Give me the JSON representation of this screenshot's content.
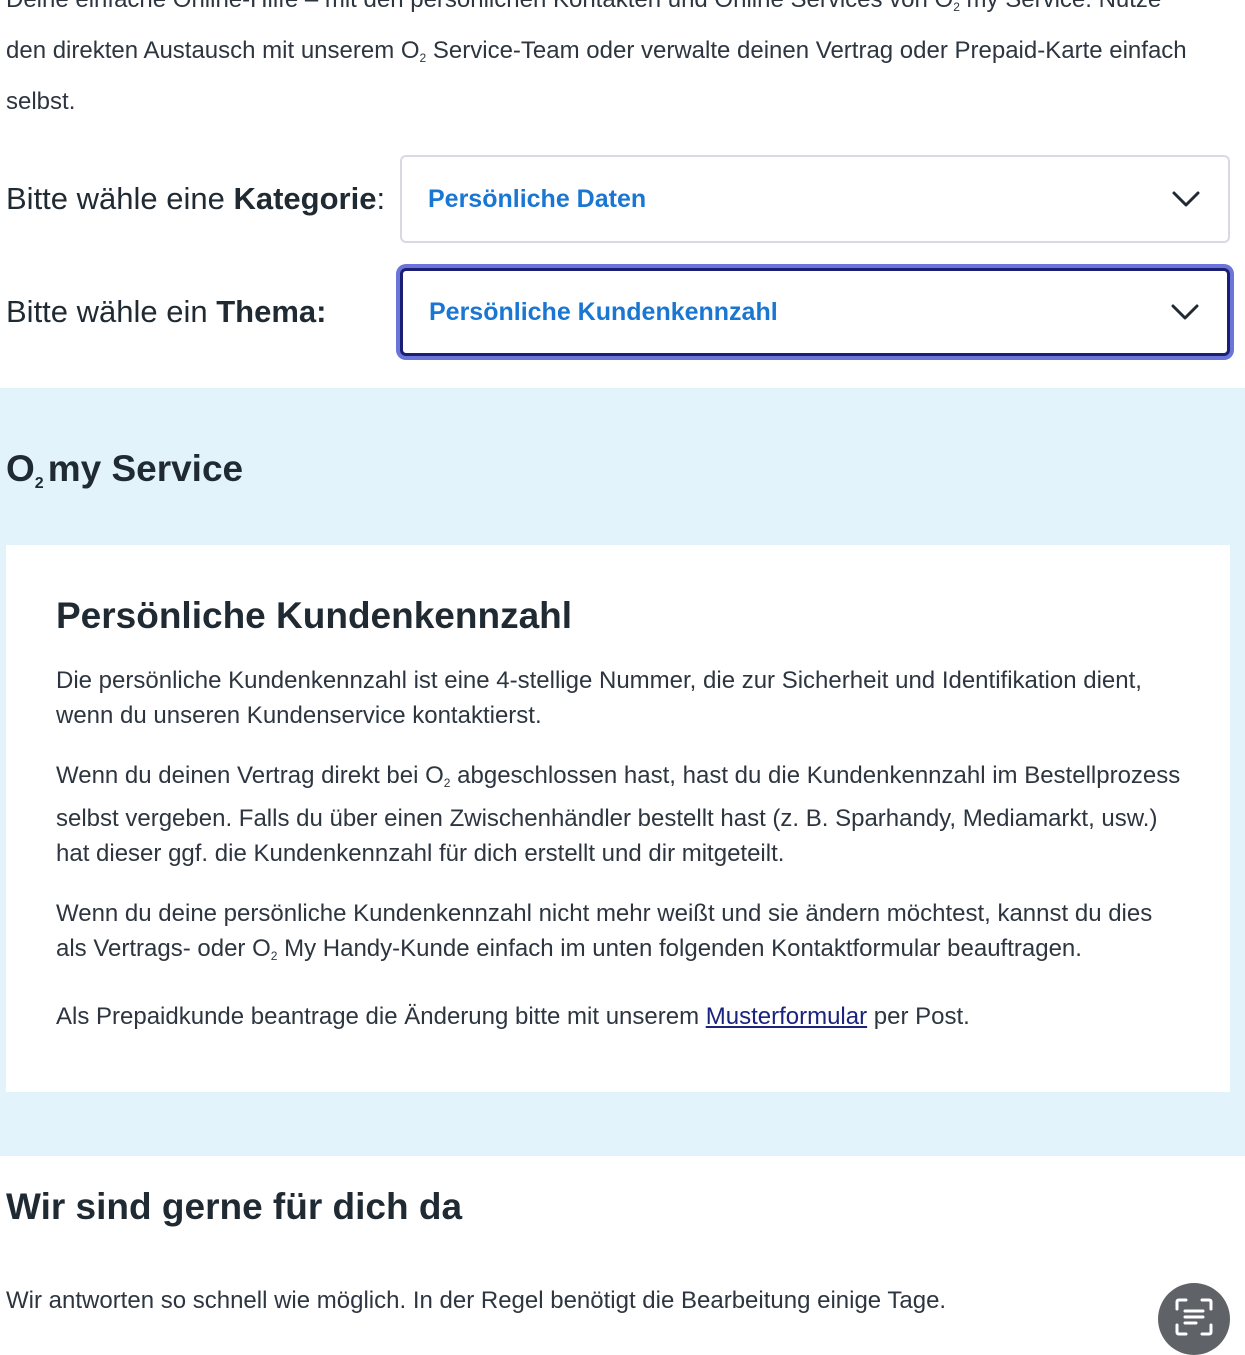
{
  "intro": {
    "line_top": "Deine einfache Online-Hilfe – mit den persönlichen Kontakten und Online Services von O",
    "line_top_sub": "2",
    "line_top_end": " my Service. Nutze",
    "line_a": "den direkten Austausch mit unserem O",
    "line_a_sub": "2",
    "line_b": " Service-Team oder verwalte deinen Vertrag oder Prepaid-Karte einfach selbst."
  },
  "category": {
    "label_prefix": "Bitte wähle eine ",
    "label_bold": "Kategorie",
    "label_suffix": ":",
    "selected": "Persönliche Daten",
    "chevron_icon": "chevron-down-icon"
  },
  "topic": {
    "label_prefix": "Bitte wähle ein ",
    "label_bold": "Thema:",
    "selected": "Persönliche Kundenkennzahl",
    "chevron_icon": "chevron-down-icon"
  },
  "service": {
    "title_o": "O",
    "title_sub": "2",
    "title_rest": "my Service",
    "background_color": "#e3f3fb"
  },
  "card": {
    "title": "Persönliche Kundenkennzahl",
    "p1": "Die persönliche Kundenkennzahl ist eine 4-stellige Nummer, die zur Sicherheit und Identifikation dient, wenn du unseren Kundenservice kontaktierst.",
    "p2_a": "Wenn du deinen Vertrag direkt bei O",
    "p2_sub": "2",
    "p2_b": " abgeschlossen hast, hast du die Kundenkennzahl im Bestellprozess selbst vergeben. Falls du über einen Zwischenhändler bestellt hast (z. B. Sparhandy, Mediamarkt, usw.) hat dieser ggf. die Kundenkennzahl für dich erstellt und dir mitgeteilt.",
    "p3_a": "Wenn du deine persönliche Kundenkennzahl nicht mehr weißt und sie ändern möchtest, kannst du dies als Vertrags- oder O",
    "p3_sub": "2",
    "p3_b": " My Handy-Kunde einfach im unten folgenden Kontaktformular beauftragen.",
    "p4_a": "Als Prepaidkunde beantrage die Änderung bitte mit unserem ",
    "p4_link": "Musterformular",
    "p4_b": " per Post."
  },
  "contact": {
    "title": "Wir sind gerne für dich da",
    "text": "Wir antworten so schnell wie möglich. In der Regel benötigt die Bearbeitung einige Tage."
  },
  "fab": {
    "icon": "text-scan-icon"
  },
  "colors": {
    "accent_blue": "#1976d2",
    "focus_ring": "#6b74d9",
    "link": "#1a237e"
  }
}
